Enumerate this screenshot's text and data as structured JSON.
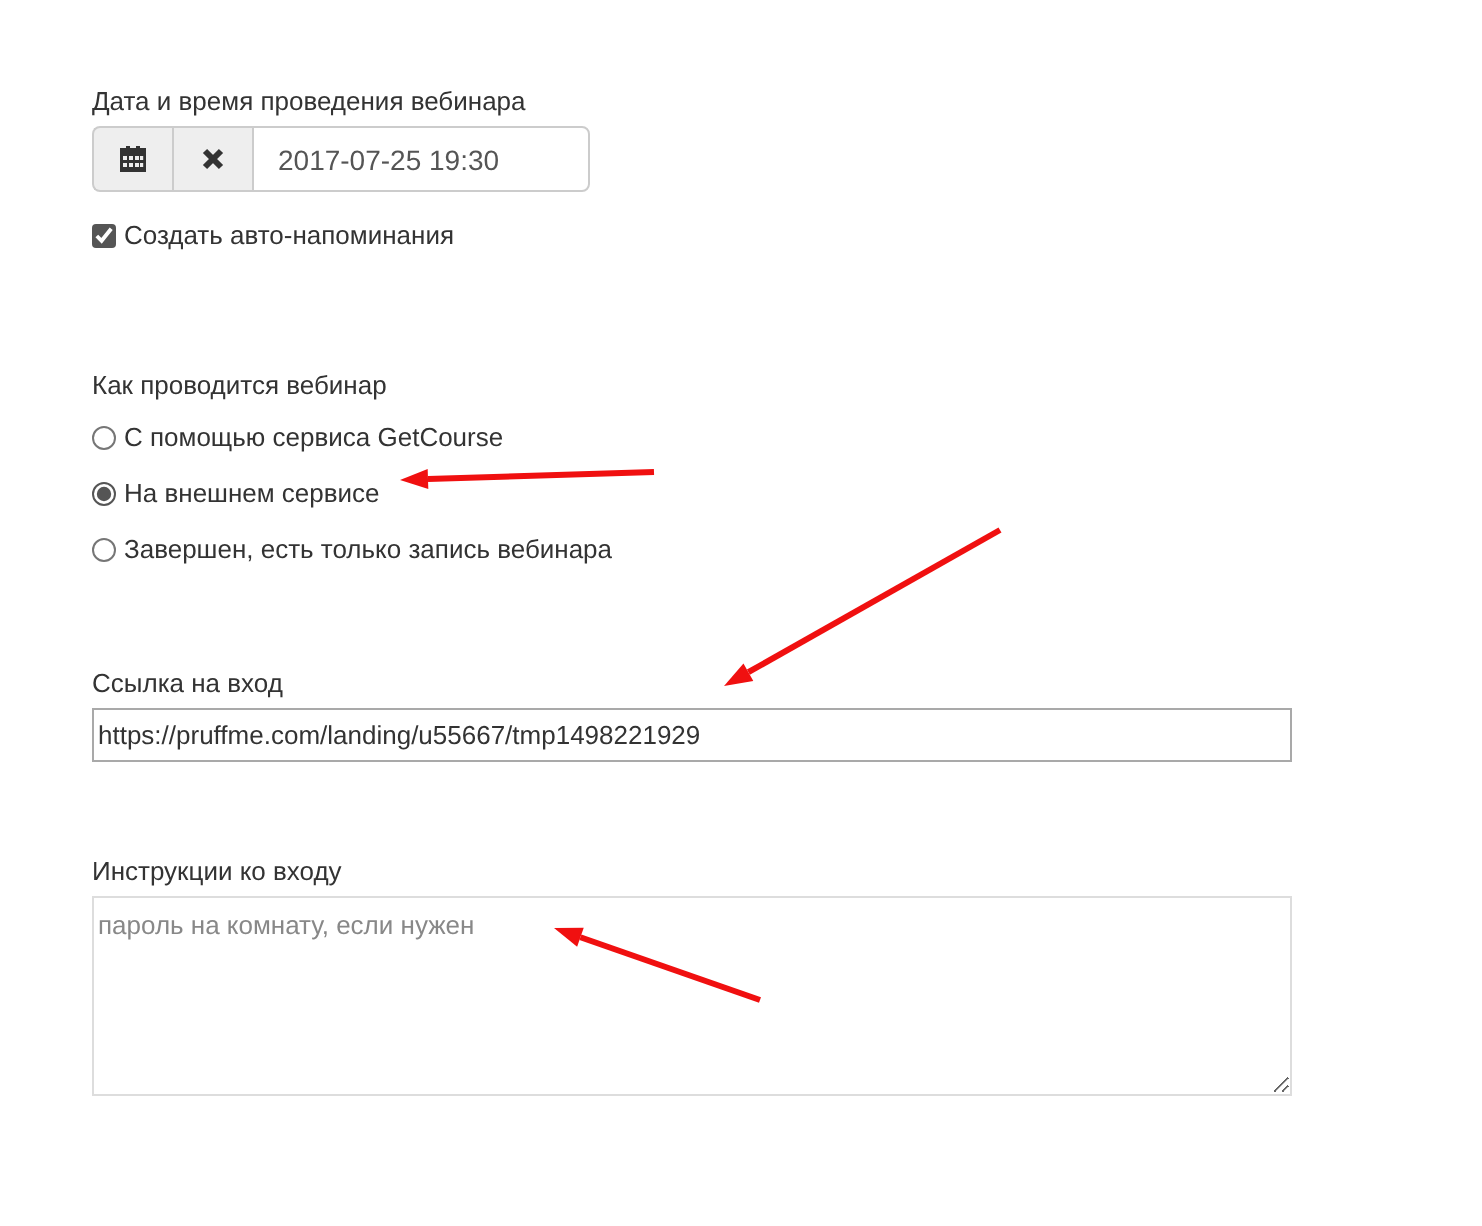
{
  "datetime": {
    "label": "Дата и время проведения вебинара",
    "value": "2017-07-25 19:30"
  },
  "reminder": {
    "label": "Создать авто-напоминания",
    "checked": true
  },
  "mode": {
    "label": "Как проводится вебинар",
    "options": [
      {
        "label": "С помощью сервиса GetCourse",
        "selected": false
      },
      {
        "label": "На внешнем сервисе",
        "selected": true
      },
      {
        "label": "Завершен, есть только запись вебинара",
        "selected": false
      }
    ]
  },
  "link": {
    "label": "Ссылка на вход",
    "value": "https://pruffme.com/landing/u55667/tmp1498221929"
  },
  "instructions": {
    "label": "Инструкции ко входу",
    "placeholder": "пароль на комнату, если нужен"
  }
}
